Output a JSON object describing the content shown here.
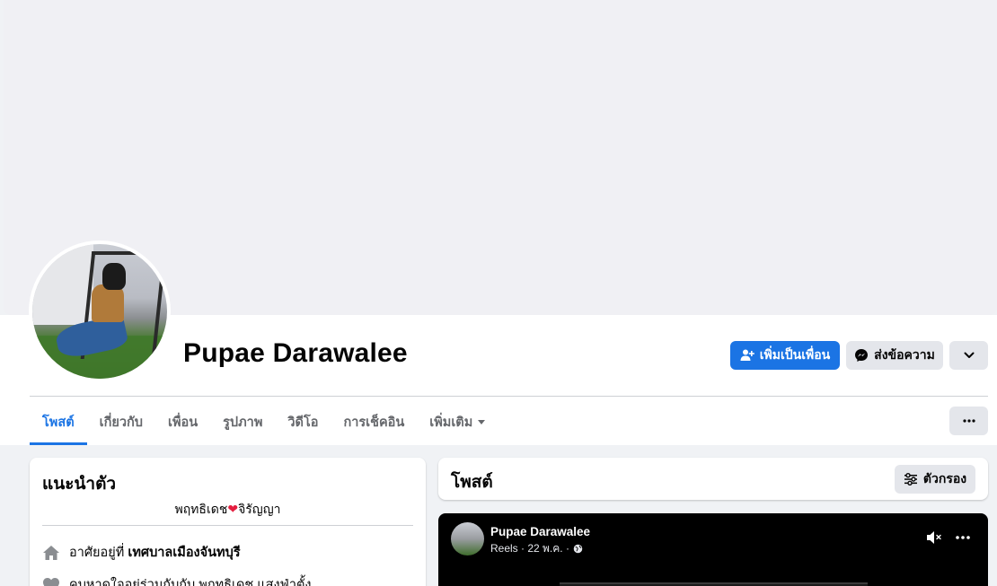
{
  "profile": {
    "name": "Pupae Darawalee"
  },
  "actions": {
    "add_friend": "เพิ่มเป็นเพื่อน",
    "message": "ส่งข้อความ"
  },
  "tabs": [
    {
      "label": "โพสต์",
      "active": true
    },
    {
      "label": "เกี่ยวกับ"
    },
    {
      "label": "เพื่อน"
    },
    {
      "label": "รูปภาพ"
    },
    {
      "label": "วิดีโอ"
    },
    {
      "label": "การเช็คอิน"
    },
    {
      "label": "เพิ่มเติม"
    }
  ],
  "intro": {
    "title": "แนะนำตัว",
    "bio_prefix": "พฤทธิเดช",
    "bio_suffix": "จิรัญญา",
    "lives_prefix": "อาศัยอยู่ที่",
    "lives_place": "เทศบาลเมืองจันทบุรี",
    "relationship": "คบหาดูใจอยู่ร่วมกับกับ พฤทธิเดช แสงฟ่าตั้ง"
  },
  "posts": {
    "title": "โพสต์",
    "filter_label": "ตัวกรอง"
  },
  "reel": {
    "author": "Pupae Darawalee",
    "meta": "Reels · 22 พ.ค. ·"
  },
  "colors": {
    "accent": "#1b74e4",
    "heart": "#e41e3f"
  }
}
